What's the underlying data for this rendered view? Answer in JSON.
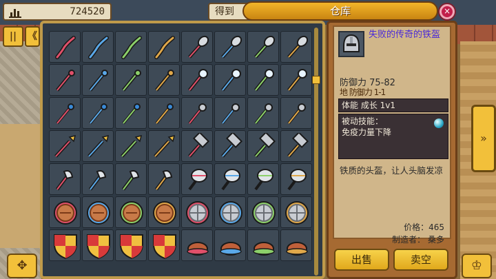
{
  "topbar": {
    "money_value": "724520",
    "get_label": "得到",
    "title": "仓库",
    "close_symbol": "×"
  },
  "left_buttons": {
    "pause_symbol": "||",
    "tab_symbol": "《",
    "move_symbol": "✥"
  },
  "item": {
    "name": "失败的传奇的铁盔",
    "defense": "防御力 75-82",
    "overlap_text": "地 防御力 1-1",
    "growth": "体能 成长 1v1",
    "skill_title": "被动技能：",
    "skill_text": "免疫力量下降",
    "description": "铁质的头盔，让人头脑发凉",
    "price": "价格：465",
    "maker": "制造者： 桑多"
  },
  "buttons": {
    "sell": "出售",
    "buy_empty": "卖空"
  },
  "right_arrow_symbol": "»",
  "corner_right_symbol": "♔",
  "inventory": {
    "rows": [
      [
        "staff-red",
        "staff-blue",
        "staff-green",
        "staff-gold",
        "shovel-red",
        "shovel-blue",
        "shovel-green",
        "shovel-gold"
      ],
      [
        "wand-red",
        "wand-blue",
        "wand-green",
        "wand-gold",
        "orbwand-red",
        "orbwand-blue",
        "orbwand-green",
        "orbwand-gold"
      ],
      [
        "rod-red",
        "rod-blue",
        "rod-green",
        "rod-gold",
        "mace-red",
        "mace-blue",
        "mace-green",
        "mace-gold"
      ],
      [
        "spear-red",
        "spear-blue",
        "spear-green",
        "spear-gold",
        "hammer-red",
        "hammer-blue",
        "hammer-green",
        "hammer-gold"
      ],
      [
        "axe-red",
        "axe-blue",
        "axe-green",
        "axe-gold",
        "battleaxe-red",
        "battleaxe-blue",
        "battleaxe-green",
        "battleaxe-gold"
      ],
      [
        "shield-red",
        "shield-blue",
        "shield-green",
        "shield-gold",
        "roundshield-red",
        "roundshield-blue",
        "roundshield-green",
        "roundshield-gold"
      ],
      [
        "kite-red",
        "kite-blue",
        "kite-green",
        "kite-gold",
        "cap-red",
        "cap-blue",
        "cap-green",
        "cap-gold"
      ]
    ]
  },
  "colors": {
    "red": "#e0506a",
    "blue": "#5aa8e8",
    "green": "#8cd06a",
    "gold": "#e0a84a",
    "title_bar": "#f2b52a",
    "panel_bg": "#2f3a45"
  }
}
